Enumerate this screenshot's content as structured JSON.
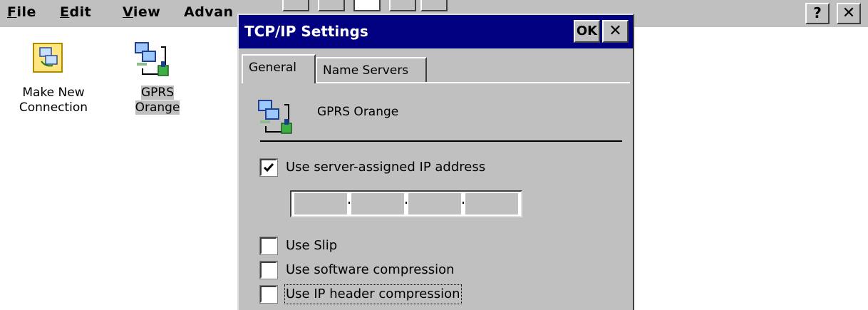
{
  "menubar": {
    "items": [
      {
        "label": "File",
        "mnemonic": "F",
        "rest": "ile"
      },
      {
        "label": "Edit",
        "mnemonic": "E",
        "rest": "dit"
      },
      {
        "label": "View",
        "mnemonic": "V",
        "rest": "iew"
      },
      {
        "label": "Advan",
        "mnemonic": "",
        "rest": "Advan"
      }
    ],
    "help_label": "?",
    "close_label": "✕"
  },
  "desktop": {
    "icons": [
      {
        "label_line1": "Make New",
        "label_line2": "Connection",
        "icon": "make-new-connection-icon",
        "selected": false
      },
      {
        "label_line1": "GPRS",
        "label_line2": "Orange",
        "icon": "network-connection-icon",
        "selected": true
      }
    ]
  },
  "dialog": {
    "title": "TCP/IP Settings",
    "ok_label": "OK",
    "close_label": "✕",
    "title_color": "#000080",
    "tabs": [
      {
        "label": "General",
        "active": true
      },
      {
        "label": "Name Servers",
        "active": false
      }
    ],
    "connection_name": "GPRS Orange",
    "options": [
      {
        "label": "Use server-assigned IP address",
        "checked": true
      },
      {
        "label": "Use Slip",
        "checked": false
      },
      {
        "label": "Use software compression",
        "checked": false
      },
      {
        "label": "Use IP header compression",
        "checked": false,
        "focused": true
      }
    ],
    "ip_address": {
      "octets": [
        "",
        "",
        "",
        ""
      ],
      "disabled": true
    }
  }
}
